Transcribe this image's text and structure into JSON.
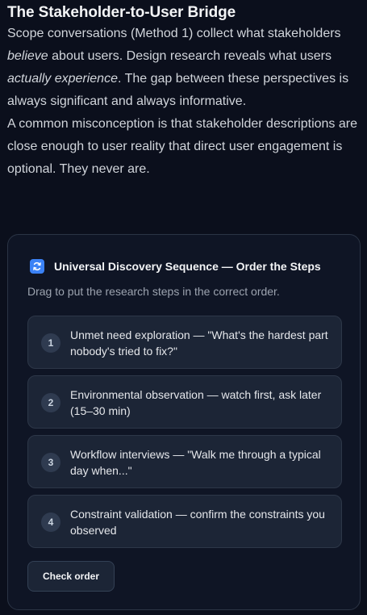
{
  "section": {
    "title": "The Stakeholder-to-User Bridge",
    "para1": {
      "a": "Scope conversations (Method 1) collect what stakeholders ",
      "b": "believe",
      "c": " about users. Design research reveals what users ",
      "d": "actually experience",
      "e": ". The gap between these perspectives is always significant and always informative."
    },
    "para2": "A common misconception is that stakeholder descriptions are close enough to user reality that direct user engagement is optional. They never are."
  },
  "exercise": {
    "icon": "refresh-icon",
    "title": "Universal Discovery Sequence — Order the Steps",
    "subtitle": "Drag to put the research steps in the correct order.",
    "steps": [
      {
        "number": "1",
        "text": "Unmet need exploration — \"What's the hardest part nobody's tried to fix?\""
      },
      {
        "number": "2",
        "text": "Environmental observation — watch first, ask later (15–30 min)"
      },
      {
        "number": "3",
        "text": "Workflow interviews — \"Walk me through a typical day when...\""
      },
      {
        "number": "4",
        "text": "Constraint validation — confirm the constraints you observed"
      }
    ],
    "check_label": "Check order"
  },
  "colors": {
    "background": "#0b0f1c",
    "card": "#0f1525",
    "step": "#1c2536",
    "accent": "#3b82f6"
  }
}
